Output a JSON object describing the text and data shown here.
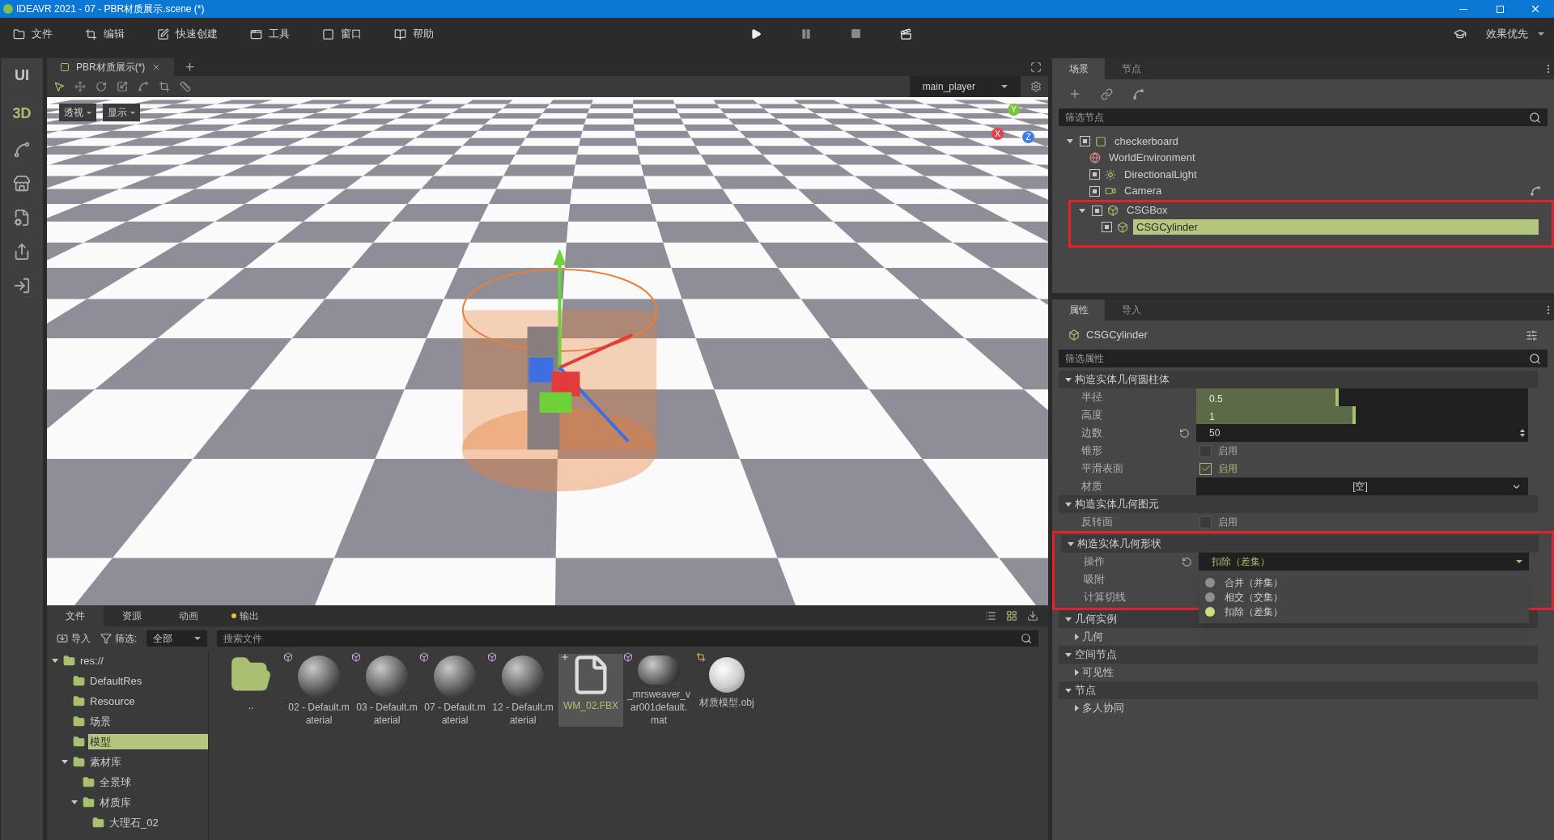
{
  "window": {
    "title": "IDEAVR 2021 - 07 - PBR材质展示.scene (*)"
  },
  "menu": [
    {
      "kind": "folder",
      "label": "文件"
    },
    {
      "kind": "crop",
      "label": "编辑"
    },
    {
      "kind": "edit",
      "label": "快速创建"
    },
    {
      "kind": "window",
      "label": "工具"
    },
    {
      "kind": "frame",
      "label": "窗口"
    },
    {
      "kind": "book",
      "label": "帮助"
    }
  ],
  "quality": "效果优先",
  "side_rail": [
    {
      "label": "UI",
      "selected": false
    },
    {
      "label": "3D",
      "selected": true
    }
  ],
  "editor_tabs": [
    {
      "label": "PBR材质展示(*)",
      "selected": true
    }
  ],
  "viewport": {
    "player": "main_player",
    "view_buttons": [
      "透视",
      "显示"
    ],
    "gizmo_axes": [
      "Y",
      "X",
      "Z"
    ]
  },
  "bottom_panel": {
    "tabs": [
      {
        "label": "文件",
        "selected": true,
        "dot": false
      },
      {
        "label": "资源",
        "selected": false,
        "dot": false
      },
      {
        "label": "动画",
        "selected": false,
        "dot": false
      },
      {
        "label": "输出",
        "selected": false,
        "dot": true
      }
    ],
    "import": "导入",
    "filter_label": "筛选:",
    "filter_value": "全部",
    "search_placeholder": "搜索文件",
    "tree": [
      {
        "name": "res://",
        "selected": false,
        "expanded": true,
        "children": [
          {
            "name": "DefaultRes",
            "selected": false
          },
          {
            "name": "Resource",
            "selected": false
          },
          {
            "name": "场景",
            "selected": false
          },
          {
            "name": "模型",
            "selected": true
          },
          {
            "name": "素材库",
            "selected": false,
            "expanded": true,
            "children": [
              {
                "name": "全景球",
                "selected": false
              },
              {
                "name": "材质库",
                "selected": false,
                "expanded": true,
                "children": [
                  {
                    "name": "大理石_02",
                    "selected": false
                  }
                ]
              }
            ]
          }
        ]
      }
    ],
    "files": [
      {
        "kind": "folder",
        "name": "..",
        "selected": false
      },
      {
        "kind": "material",
        "name": "02 - Default.material",
        "selected": false
      },
      {
        "kind": "material",
        "name": "03 - Default.material",
        "selected": false
      },
      {
        "kind": "material",
        "name": "07 - Default.material",
        "selected": false
      },
      {
        "kind": "material",
        "name": "12 - Default.material",
        "selected": false
      },
      {
        "kind": "file",
        "name": "WM_02.FBX",
        "selected": true
      },
      {
        "kind": "material",
        "name": "_mrsweaver_var001default.mat",
        "selected": false
      },
      {
        "kind": "model",
        "name": "材质模型.obj",
        "selected": false
      }
    ]
  },
  "scene_panel": {
    "tabs": [
      {
        "label": "场景",
        "selected": true
      },
      {
        "label": "节点",
        "selected": false
      }
    ],
    "filter_placeholder": "筛选节点",
    "nodes": [
      {
        "name": "checkerboard",
        "kind": "mesh",
        "toggle": true,
        "expanded": true,
        "selected": false,
        "highlighted": false,
        "children": [
          {
            "name": "WorldEnvironment",
            "kind": "environment",
            "toggle": false,
            "selected": false,
            "highlighted": false
          },
          {
            "name": "DirectionalLight",
            "kind": "light",
            "toggle": true,
            "selected": false,
            "highlighted": false
          },
          {
            "name": "Camera",
            "kind": "camera",
            "toggle": true,
            "selected": false,
            "highlighted": false,
            "path_icon": true
          },
          {
            "name": "CSGBox",
            "kind": "csg",
            "toggle": true,
            "expanded": true,
            "selected": false,
            "highlighted": true,
            "children": [
              {
                "name": "CSGCylinder",
                "kind": "csg",
                "toggle": true,
                "selected": true,
                "highlighted": false
              }
            ]
          }
        ]
      }
    ]
  },
  "inspector": {
    "tabs": [
      {
        "label": "属性",
        "selected": true
      },
      {
        "label": "导入",
        "selected": false
      }
    ],
    "node": "CSGCylinder",
    "filter_placeholder": "筛选属性",
    "sections": [
      {
        "title": "构造实体几何圆柱体",
        "expanded": true,
        "highlighted": false,
        "items": [
          {
            "kind": "slider",
            "label": "半径",
            "value": "0.5",
            "level": 0.43
          },
          {
            "kind": "slider",
            "label": "高度",
            "value": "1",
            "level": 0.48
          },
          {
            "kind": "spin",
            "label": "边数",
            "value": "50",
            "reset": true
          },
          {
            "kind": "checkbox",
            "label": "锥形",
            "checked": false,
            "text": "启用"
          },
          {
            "kind": "checkbox",
            "label": "平滑表面",
            "checked": true,
            "text": "启用"
          },
          {
            "kind": "select",
            "label": "材质",
            "value": "[空]"
          }
        ]
      },
      {
        "title": "构造实体几何图元",
        "expanded": true,
        "highlighted": false,
        "items": [
          {
            "kind": "checkbox",
            "label": "反转面",
            "checked": false,
            "text": "启用"
          }
        ]
      },
      {
        "title": "构造实体几何形状",
        "expanded": true,
        "highlighted": true,
        "items": [
          {
            "kind": "dropdown",
            "label": "操作",
            "value": "扣除（差集）",
            "reset": true,
            "open": true,
            "options": [
              {
                "label": "合并（并集）",
                "selected": false
              },
              {
                "label": "相交（交集）",
                "selected": false
              },
              {
                "label": "扣除（差集）",
                "selected": true
              }
            ]
          },
          {
            "kind": "hidden",
            "label": "吸附"
          },
          {
            "kind": "hidden",
            "label": "计算切线"
          }
        ]
      },
      {
        "title": "几何实例",
        "expanded": true,
        "highlighted": false,
        "items": [
          {
            "kind": "group",
            "label": "几何",
            "expanded": false
          }
        ]
      },
      {
        "title": "空间节点",
        "expanded": true,
        "highlighted": false,
        "items": [
          {
            "kind": "group",
            "label": "可见性",
            "expanded": false
          }
        ]
      },
      {
        "title": "节点",
        "expanded": true,
        "highlighted": false,
        "items": [
          {
            "kind": "group",
            "label": "多人协同",
            "expanded": false
          }
        ]
      }
    ]
  }
}
